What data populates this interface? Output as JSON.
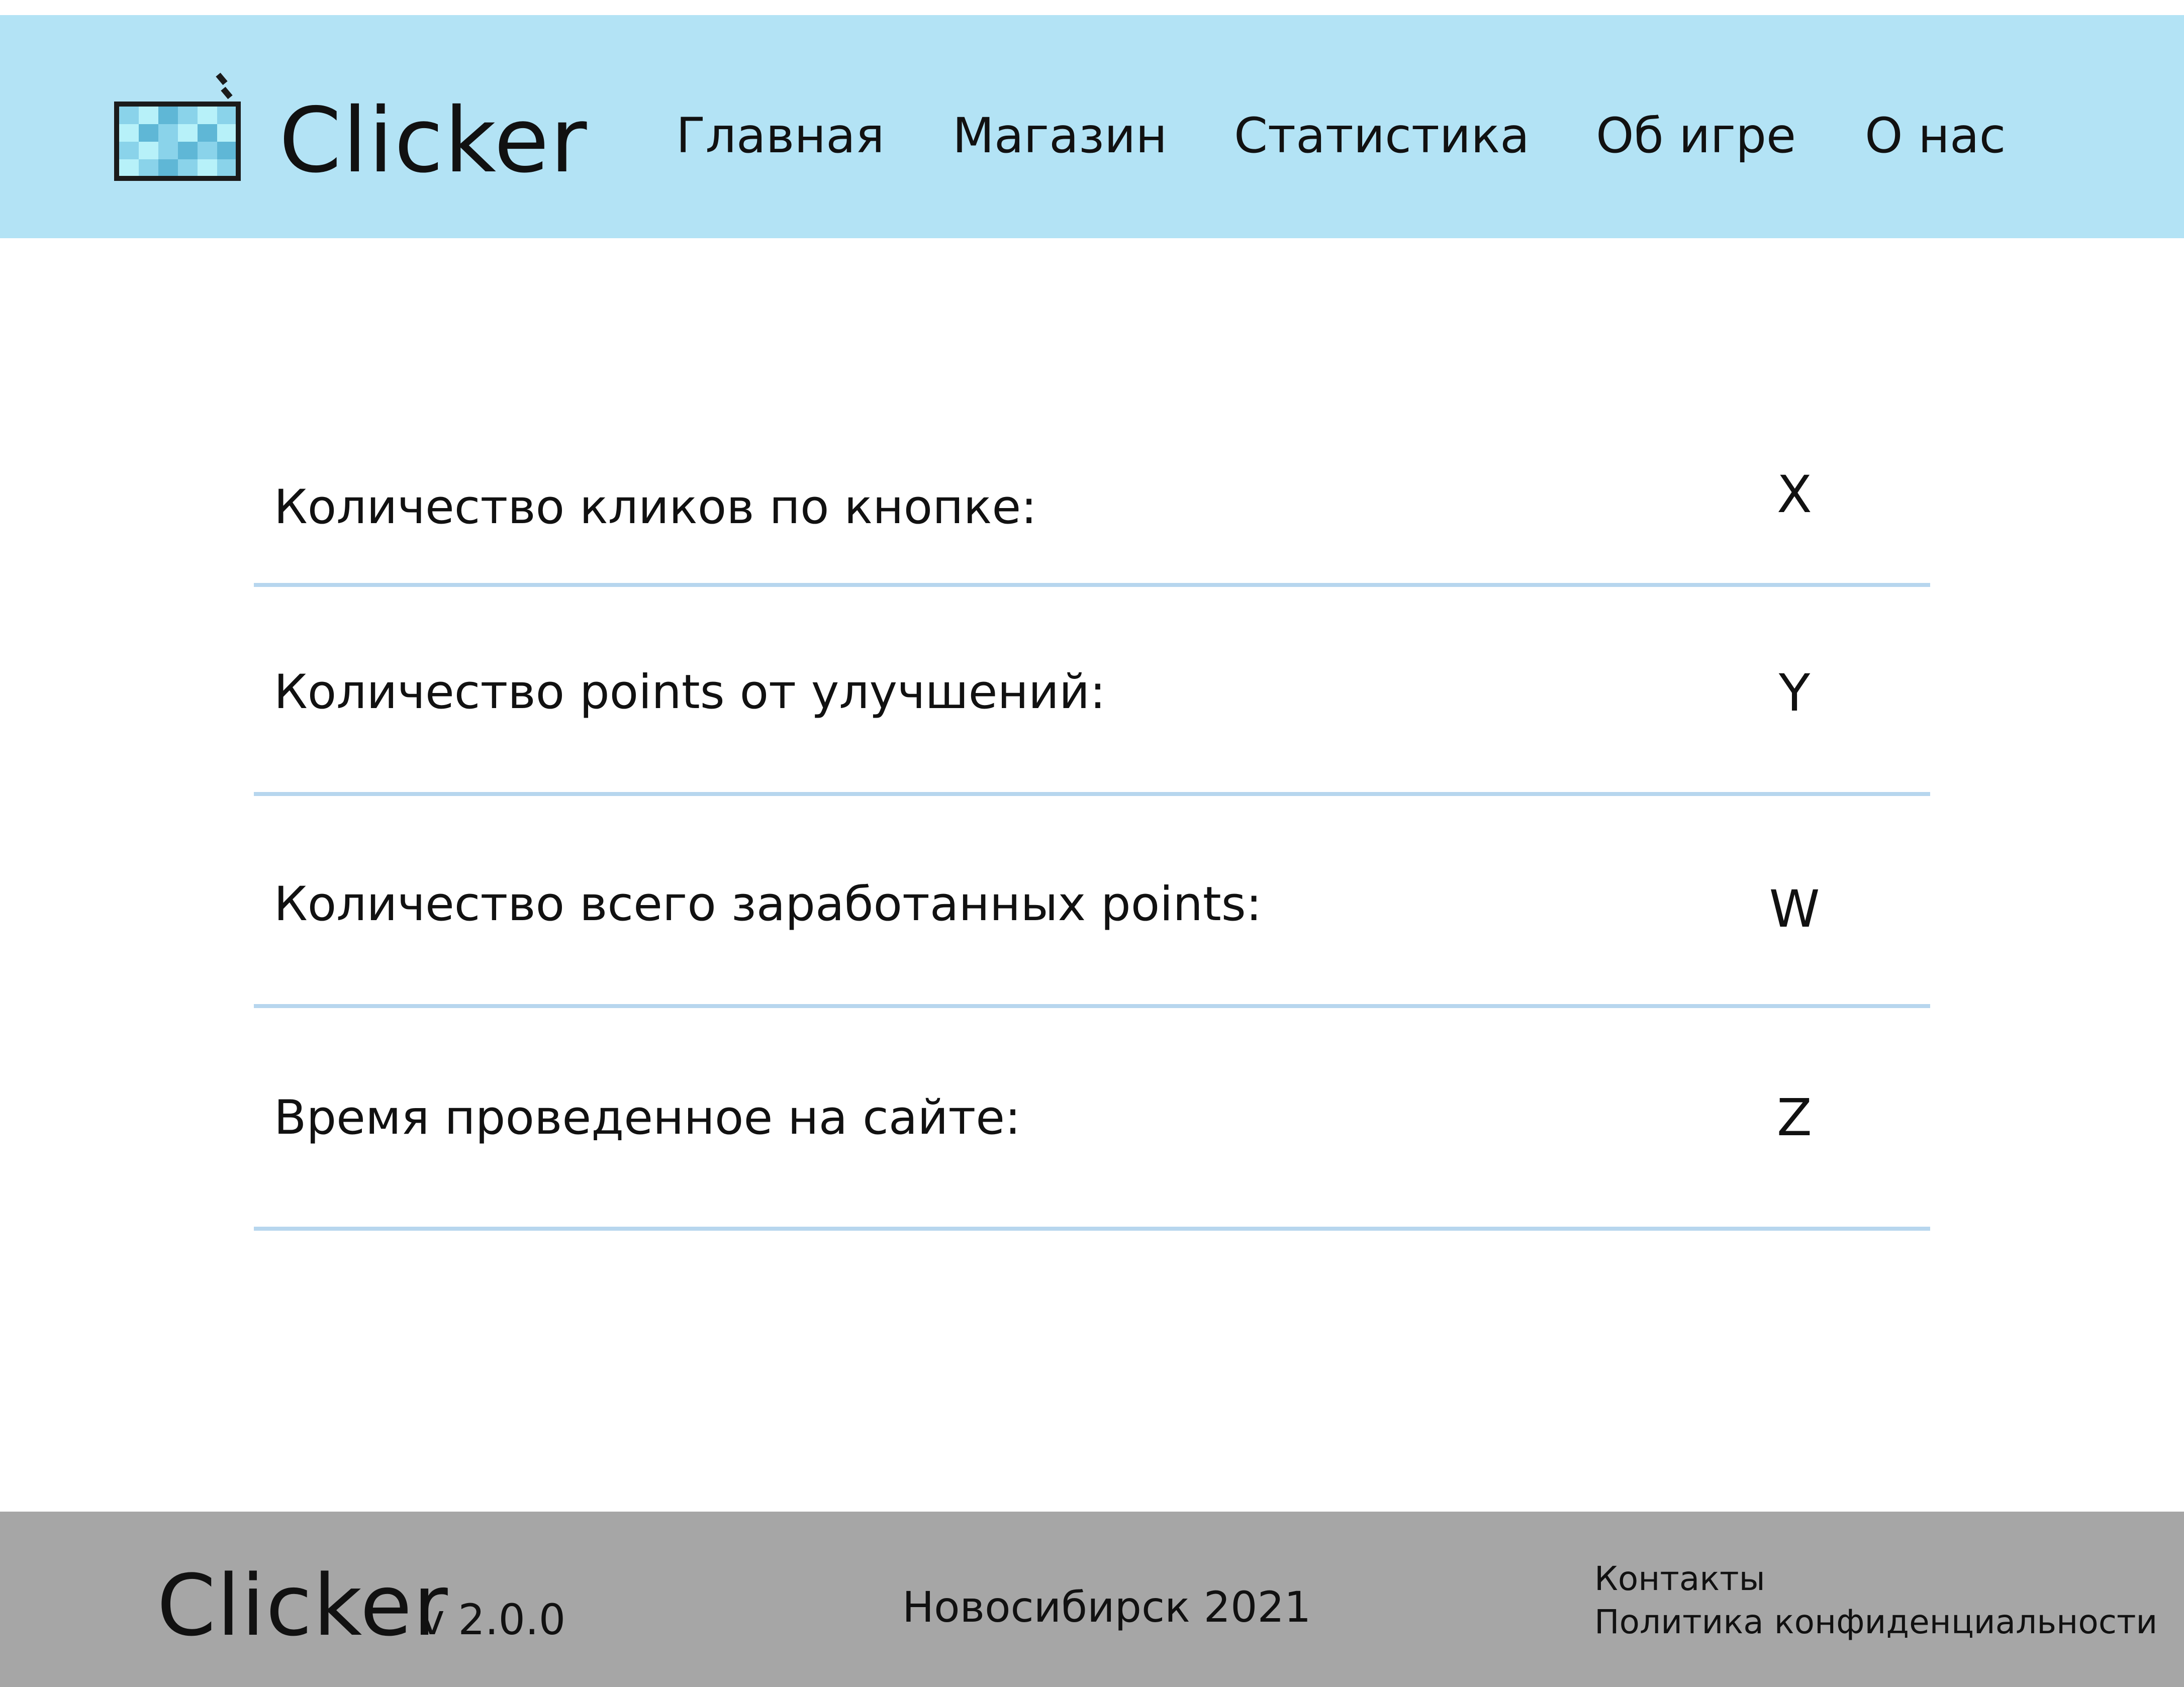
{
  "header": {
    "brand": "Clicker",
    "nav": [
      "Главная",
      "Магазин",
      "Статистика",
      "Об игре",
      "О нас"
    ]
  },
  "stats": [
    {
      "label": "Количество кликов по кнопке:",
      "value": "X"
    },
    {
      "label": "Количество points от улучшений:",
      "value": "Y"
    },
    {
      "label": "Количество всего заработанных points:",
      "value": "W"
    },
    {
      "label": "Время проведенное на сайте:",
      "value": "Z"
    }
  ],
  "footer": {
    "brand": "Clicker",
    "version": "v 2.0.0",
    "city_year": "Новосибирск 2021",
    "links": [
      "Контакты",
      "Политика конфиденциальности"
    ]
  },
  "colors": {
    "header_bg": "#b3e3f5",
    "divider": "#b7d6ee",
    "footer_bg": "#a6a6a6",
    "text": "#111111"
  },
  "icons": {
    "logo": "pixel-screen-icon"
  }
}
